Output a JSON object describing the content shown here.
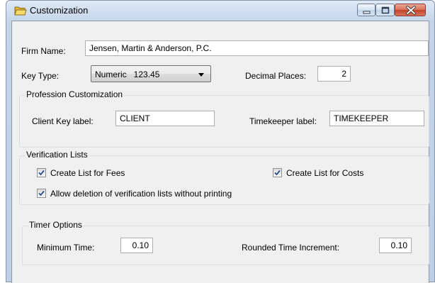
{
  "window": {
    "title": "Customization",
    "colors": {
      "frame": "#c4d5ea",
      "close_button": "#c4432a",
      "client_bg": "#f0f0f0"
    }
  },
  "firm": {
    "label": "Firm Name:",
    "value": "Jensen, Martin & Anderson, P.C."
  },
  "key_type": {
    "label": "Key Type:",
    "selected": "Numeric   123.45"
  },
  "decimal_places": {
    "label": "Decimal Places:",
    "value": "2"
  },
  "profession": {
    "title": "Profession Customization",
    "client_key_label": "Client Key label:",
    "client_key_value": "CLIENT",
    "timekeeper_label": "Timekeeper label:",
    "timekeeper_value": "TIMEKEEPER"
  },
  "verification": {
    "title": "Verification Lists",
    "fees_label": "Create List for Fees",
    "fees_checked": true,
    "costs_label": "Create List for Costs",
    "costs_checked": true,
    "allow_delete_label": "Allow deletion of verification lists without printing",
    "allow_delete_checked": true
  },
  "timer": {
    "title": "Timer Options",
    "min_time_label": "Minimum Time:",
    "min_time_value": "0.10",
    "rounded_label": "Rounded Time Increment:",
    "rounded_value": "0.10"
  },
  "icons": [
    "folder-icon",
    "minimize-icon",
    "maximize-icon",
    "close-icon",
    "dropdown-arrow-icon",
    "checkmark-icon"
  ]
}
